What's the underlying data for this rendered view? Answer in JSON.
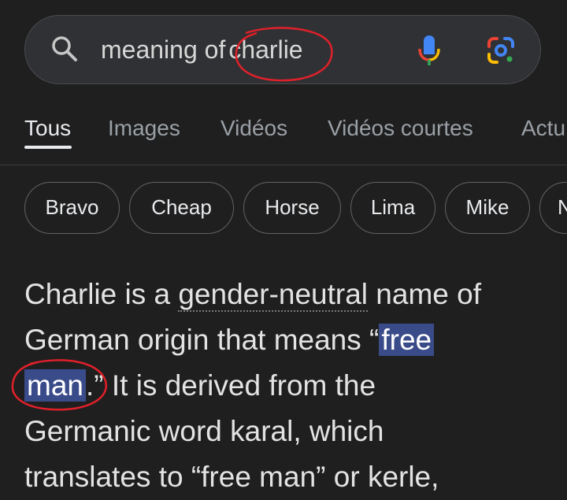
{
  "search": {
    "query_prefix": "meaning of",
    "query_highlight": "charlie",
    "icons": [
      "search-icon",
      "mic-icon",
      "google-lens-icon"
    ]
  },
  "tabs": [
    {
      "label": "Tous",
      "active": true
    },
    {
      "label": "Images",
      "active": false
    },
    {
      "label": "Vidéos",
      "active": false
    },
    {
      "label": "Vidéos courtes",
      "active": false
    },
    {
      "label": "Actu",
      "active": false
    }
  ],
  "chips": [
    "Bravo",
    "Cheap",
    "Horse",
    "Lima",
    "Mike",
    "N"
  ],
  "answer": {
    "l1_a": "Charlie is a ",
    "l1_b": "gender-neutral",
    "l1_c": " name of",
    "l2_a": "German origin that means “",
    "l2_b": "free",
    "l3_a": "man",
    "l3_b": ".” It is derived from the",
    "l4": "Germanic word karal, which",
    "l5": "translates to “free man” or kerle,"
  },
  "colors": {
    "background": "#1f1f1f",
    "search_bar": "#303134",
    "highlight": "#3a4b8a",
    "annotation": "#e0202a"
  }
}
